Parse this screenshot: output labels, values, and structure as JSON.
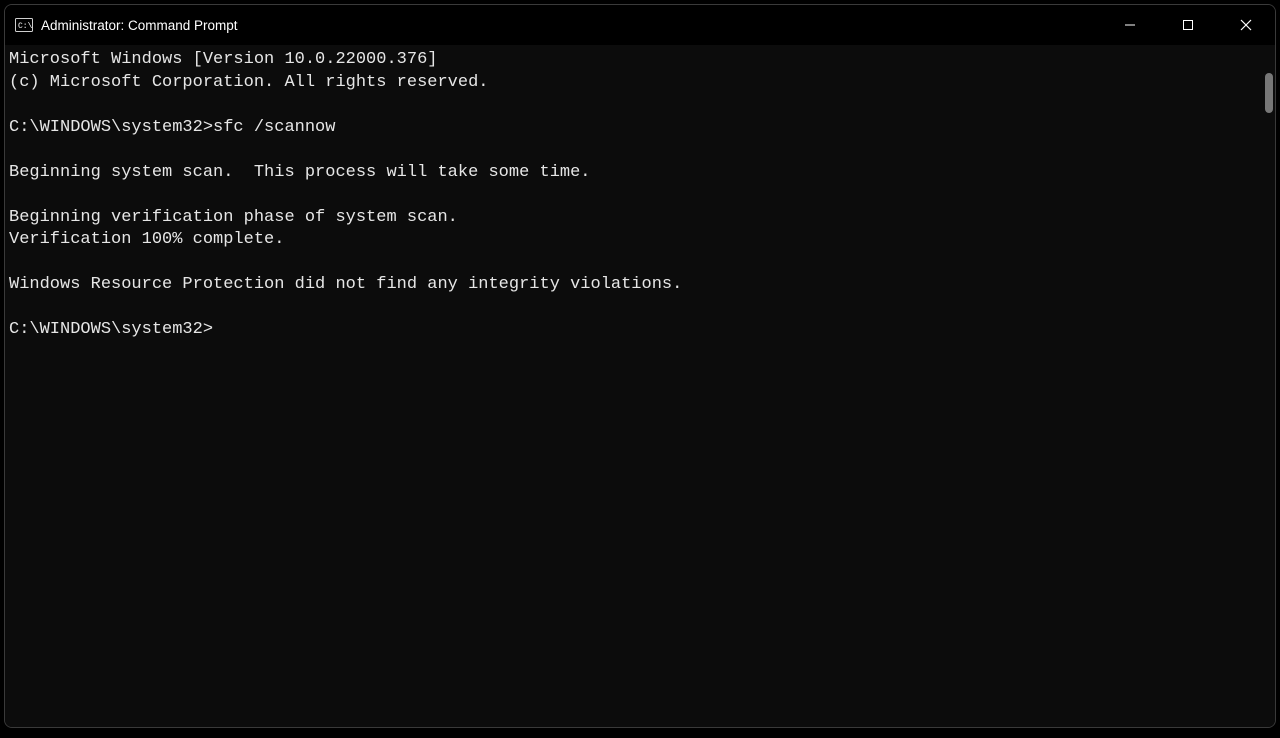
{
  "titlebar": {
    "title": "Administrator: Command Prompt"
  },
  "console": {
    "lines": [
      "Microsoft Windows [Version 10.0.22000.376]",
      "(c) Microsoft Corporation. All rights reserved.",
      "",
      "C:\\WINDOWS\\system32>sfc /scannow",
      "",
      "Beginning system scan.  This process will take some time.",
      "",
      "Beginning verification phase of system scan.",
      "Verification 100% complete.",
      "",
      "Windows Resource Protection did not find any integrity violations.",
      "",
      "C:\\WINDOWS\\system32>"
    ]
  }
}
